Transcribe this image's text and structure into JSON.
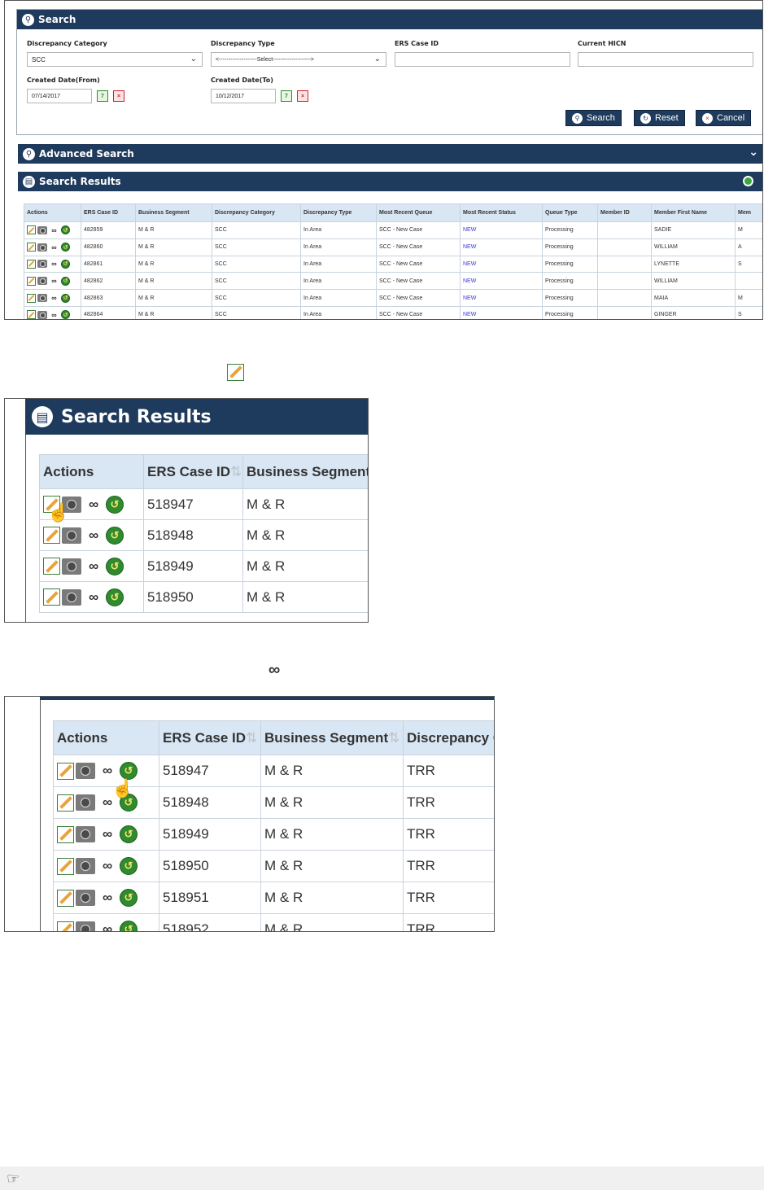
{
  "search": {
    "title": "Search",
    "fields": {
      "discrepancy_category_label": "Discrepancy Category",
      "discrepancy_category_value": "SCC",
      "discrepancy_type_label": "Discrepancy Type",
      "discrepancy_type_value": "<--------------------Select-------------------->",
      "ers_case_id_label": "ERS Case ID",
      "ers_case_id_value": "",
      "current_hicn_label": "Current HICN",
      "current_hicn_value": "",
      "created_from_label": "Created Date(From)",
      "created_from_value": "07/14/2017",
      "created_to_label": "Created Date(To)",
      "created_to_value": "10/12/2017"
    },
    "buttons": {
      "search": "Search",
      "reset": "Reset",
      "cancel": "Cancel"
    }
  },
  "advanced_search": {
    "title": "Advanced Search"
  },
  "results": {
    "title": "Search Results",
    "columns": [
      "Actions",
      "ERS Case ID",
      "Business Segment",
      "Discrepancy Category",
      "Discrepancy Type",
      "Most Recent Queue",
      "Most Recent Status",
      "Queue Type",
      "Member ID",
      "Member First Name",
      "Mem"
    ],
    "rows": [
      {
        "id": "482859",
        "segment": "M & R",
        "category": "SCC",
        "type": "In Area",
        "queue": "SCC - New Case",
        "status": "NEW",
        "queue_type": "Processing",
        "member_id": "",
        "first_name": "SADIE",
        "mi": "M"
      },
      {
        "id": "482860",
        "segment": "M & R",
        "category": "SCC",
        "type": "In Area",
        "queue": "SCC - New Case",
        "status": "NEW",
        "queue_type": "Processing",
        "member_id": "",
        "first_name": "WILLIAM",
        "mi": "A"
      },
      {
        "id": "482861",
        "segment": "M & R",
        "category": "SCC",
        "type": "In Area",
        "queue": "SCC - New Case",
        "status": "NEW",
        "queue_type": "Processing",
        "member_id": "",
        "first_name": "LYNETTE",
        "mi": "S"
      },
      {
        "id": "482862",
        "segment": "M & R",
        "category": "SCC",
        "type": "In Area",
        "queue": "SCC - New Case",
        "status": "NEW",
        "queue_type": "Processing",
        "member_id": "",
        "first_name": "WILLIAM",
        "mi": ""
      },
      {
        "id": "482863",
        "segment": "M & R",
        "category": "SCC",
        "type": "In Area",
        "queue": "SCC - New Case",
        "status": "NEW",
        "queue_type": "Processing",
        "member_id": "",
        "first_name": "MAIA",
        "mi": "M"
      },
      {
        "id": "482864",
        "segment": "M & R",
        "category": "SCC",
        "type": "In Area",
        "queue": "SCC - New Case",
        "status": "NEW",
        "queue_type": "Processing",
        "member_id": "",
        "first_name": "GINGER",
        "mi": "S"
      }
    ]
  },
  "zoom_edit": {
    "title": "Search Results",
    "columns": [
      "Actions",
      "ERS Case ID",
      "Business Segment"
    ],
    "rows": [
      {
        "id": "518947",
        "segment": "M & R"
      },
      {
        "id": "518948",
        "segment": "M & R"
      },
      {
        "id": "518949",
        "segment": "M & R"
      },
      {
        "id": "518950",
        "segment": "M & R"
      }
    ]
  },
  "zoom_view": {
    "columns": [
      "Actions",
      "ERS Case ID",
      "Business Segment",
      "Discrepancy C"
    ],
    "rows": [
      {
        "id": "518947",
        "segment": "M & R",
        "category": "TRR"
      },
      {
        "id": "518948",
        "segment": "M & R",
        "category": "TRR"
      },
      {
        "id": "518949",
        "segment": "M & R",
        "category": "TRR"
      },
      {
        "id": "518950",
        "segment": "M & R",
        "category": "TRR"
      },
      {
        "id": "518951",
        "segment": "M & R",
        "category": "TRR"
      },
      {
        "id": "518952",
        "segment": "M & R",
        "category": "TRR"
      }
    ]
  },
  "icons": {
    "edit": "edit-pencil-icon",
    "snapshot": "camera-icon",
    "view": "glasses-icon",
    "history": "globe-icon",
    "note": "pointing-hand-icon"
  }
}
